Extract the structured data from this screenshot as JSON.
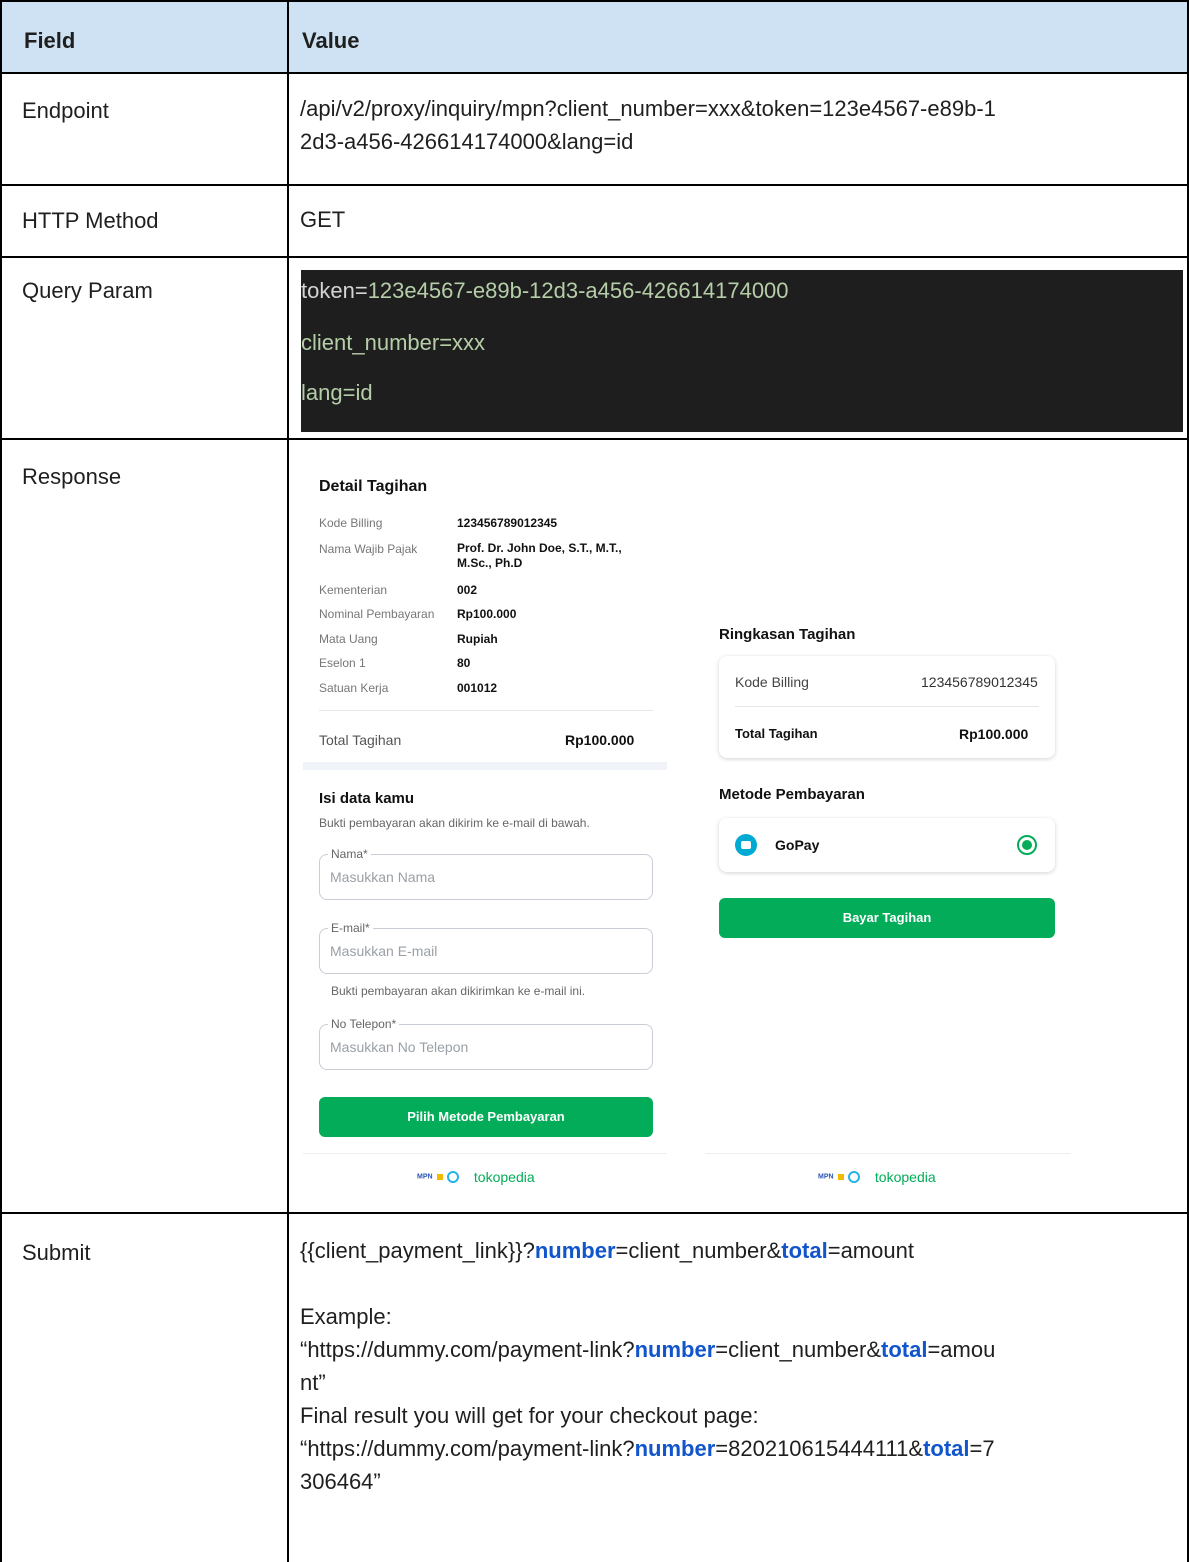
{
  "table": {
    "header": {
      "field": "Field",
      "value": "Value"
    },
    "endpoint": {
      "label": "Endpoint",
      "value_line1": "/api/v2/proxy/inquiry/mpn?client_number=xxx&token=123e4567-e89b-1",
      "value_line2": "2d3-a456-426614174000&lang=id"
    },
    "method": {
      "label": "HTTP Method",
      "value": "GET"
    },
    "query": {
      "label": "Query Param",
      "lines": [
        {
          "key": "token",
          "eq": "=",
          "val": "123e4567-e89b-12d3-a456-426614174000"
        },
        {
          "key": "",
          "eq": "",
          "val": "client_number=xxx"
        },
        {
          "key": "",
          "eq": "",
          "val": "lang=id"
        }
      ]
    },
    "response": {
      "label": "Response"
    },
    "submit": {
      "label": "Submit",
      "line1": {
        "pre": "{{client_payment_link}}?",
        "k1": "number",
        "mid": "=client_number&",
        "k2": "total",
        "post": "=amount"
      },
      "example": "Example:",
      "line2": {
        "pre": "“https://dummy.com/payment-link?",
        "k1": "number",
        "mid": "=client_number&",
        "k2": "total",
        "post": "=amou"
      },
      "line2b": "nt”",
      "final": "Final result you will get for your checkout page:",
      "line3": {
        "pre": "“https://dummy.com/payment-link?",
        "k1": "number",
        "mid": "=820210615444111&",
        "k2": "total",
        "post": "=7"
      },
      "line3b": "306464”"
    }
  },
  "screen_left": {
    "title": "Detail Tagihan",
    "rows": [
      {
        "k": "Kode Billing",
        "v": "123456789012345"
      },
      {
        "k": "Nama Wajib Pajak",
        "v": "Prof. Dr. John Doe, S.T., M.T.,",
        "v2": "M.Sc., Ph.D"
      },
      {
        "k": "Kementerian",
        "v": "002"
      },
      {
        "k": "Nominal Pembayaran",
        "v": "Rp100.000"
      },
      {
        "k": "Mata Uang",
        "v": "Rupiah"
      },
      {
        "k": "Eselon 1",
        "v": "80"
      },
      {
        "k": "Satuan Kerja",
        "v": "001012"
      }
    ],
    "total_label": "Total Tagihan",
    "total_value": "Rp100.000",
    "form_title": "Isi data kamu",
    "form_sub": "Bukti pembayaran akan dikirim ke e-mail di bawah.",
    "name_label": "Nama*",
    "name_ph": "Masukkan Nama",
    "email_label": "E-mail*",
    "email_ph": "Masukkan E-mail",
    "email_help": "Bukti pembayaran akan dikirimkan ke e-mail ini.",
    "phone_label": "No Telepon*",
    "phone_ph": "Masukkan No Telepon",
    "button": "Pilih Metode Pembayaran",
    "brand_mpn": "MPN",
    "brand_name": "tokopedia"
  },
  "screen_right": {
    "summary_title": "Ringkasan Tagihan",
    "billing_label": "Kode Billing",
    "billing_value": "123456789012345",
    "total_label": "Total Tagihan",
    "total_value": "Rp100.000",
    "method_title": "Metode Pembayaran",
    "method_name": "GoPay",
    "button": "Bayar Tagihan",
    "brand_mpn": "MPN",
    "brand_name": "tokopedia"
  }
}
